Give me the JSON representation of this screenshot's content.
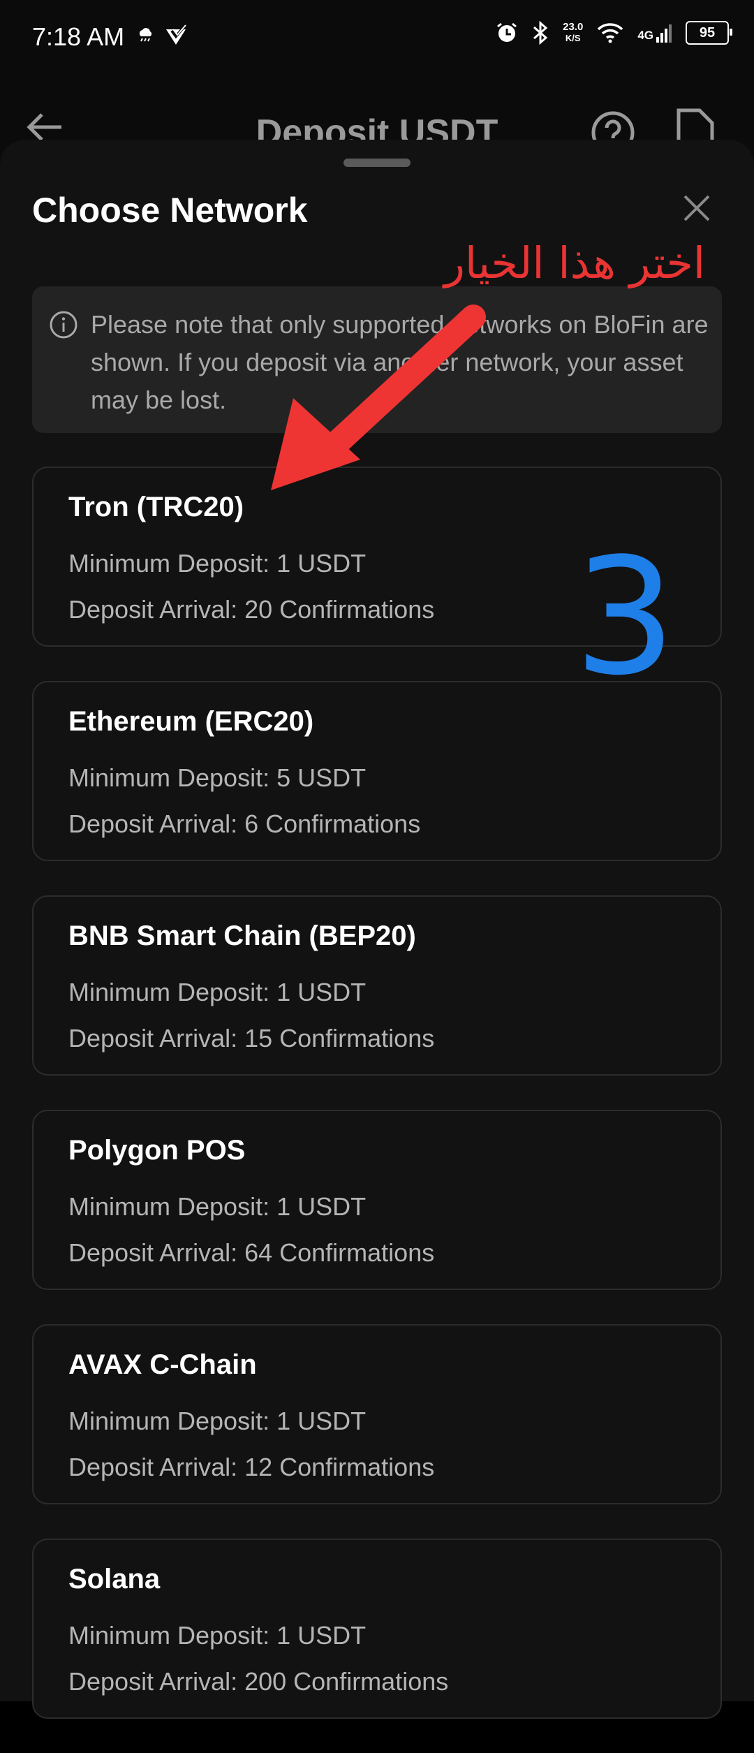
{
  "status_bar": {
    "time": "7:18 AM",
    "net_speed_value": "23.0",
    "net_speed_unit": "K/S",
    "network_gen": "4G",
    "battery": "95"
  },
  "header": {
    "title": "Deposit USDT"
  },
  "sheet": {
    "title": "Choose Network",
    "notice": "Please note that only supported networks on BloFin are shown. If you deposit via another network, your asset may be lost."
  },
  "networks": [
    {
      "name": "Tron (TRC20)",
      "min_deposit": "Minimum Deposit: 1 USDT",
      "arrival": "Deposit Arrival: 20 Confirmations"
    },
    {
      "name": "Ethereum (ERC20)",
      "min_deposit": "Minimum Deposit: 5 USDT",
      "arrival": "Deposit Arrival: 6 Confirmations"
    },
    {
      "name": "BNB Smart Chain (BEP20)",
      "min_deposit": "Minimum Deposit: 1 USDT",
      "arrival": "Deposit Arrival: 15 Confirmations"
    },
    {
      "name": "Polygon POS",
      "min_deposit": "Minimum Deposit: 1 USDT",
      "arrival": "Deposit Arrival: 64 Confirmations"
    },
    {
      "name": "AVAX C-Chain",
      "min_deposit": "Minimum Deposit: 1 USDT",
      "arrival": "Deposit Arrival: 12 Confirmations"
    },
    {
      "name": "Solana",
      "min_deposit": "Minimum Deposit: 1 USDT",
      "arrival": "Deposit Arrival: 200 Confirmations"
    }
  ],
  "annotation": {
    "instruction_text": "اختر هذا الخيار",
    "step_number": "3",
    "text_color": "#ea3434",
    "number_color": "#1f7fe8"
  },
  "colors": {
    "background": "#000000",
    "sheet": "#121212",
    "notice_bg": "#232323",
    "card_border": "#2c2c2c",
    "muted_text": "#b5b5b5"
  }
}
